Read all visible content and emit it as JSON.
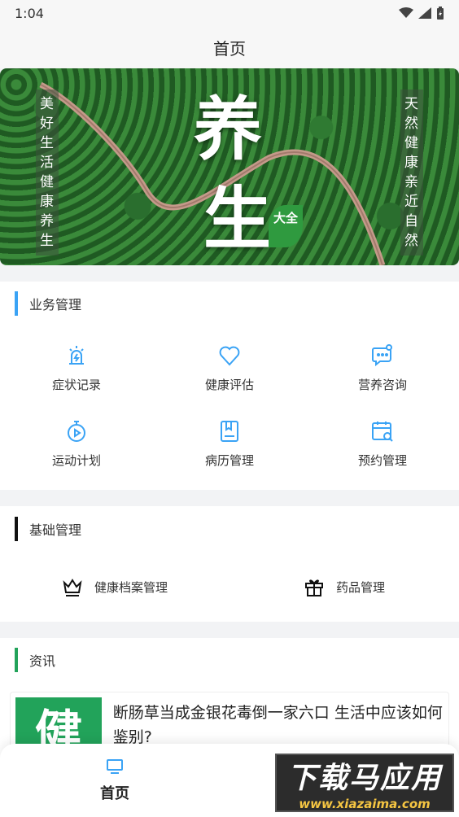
{
  "status": {
    "time": "1:04"
  },
  "header": {
    "title": "首页"
  },
  "banner": {
    "left_text": "美好生活 健康养生",
    "right_text": "天然健康 亲近自然",
    "title_line1": "养",
    "title_line2": "生",
    "badge": "大全"
  },
  "business": {
    "title": "业务管理",
    "accent": "#3aa3f5",
    "items": [
      {
        "label": "症状记录",
        "icon": "alarm-icon"
      },
      {
        "label": "健康评估",
        "icon": "heart-icon"
      },
      {
        "label": "营养咨询",
        "icon": "chat-icon"
      },
      {
        "label": "运动计划",
        "icon": "stopwatch-icon"
      },
      {
        "label": "病历管理",
        "icon": "record-book-icon"
      },
      {
        "label": "预约管理",
        "icon": "calendar-search-icon"
      }
    ]
  },
  "basic": {
    "title": "基础管理",
    "accent": "#111111",
    "items": [
      {
        "label": "健康档案管理",
        "icon": "crown-icon"
      },
      {
        "label": "药品管理",
        "icon": "gift-icon"
      }
    ]
  },
  "news": {
    "title": "资讯",
    "accent": "#22a35a",
    "items": [
      {
        "thumb_text": "健",
        "title": "断肠草当成金银花毒倒一家六口 生活中应该如何鉴别?"
      }
    ]
  },
  "tabbar": {
    "tabs": [
      {
        "label": "首页",
        "icon": "monitor-icon"
      }
    ]
  },
  "watermark": {
    "main": "下载马应用",
    "sub": "www.xiazaima.com"
  }
}
